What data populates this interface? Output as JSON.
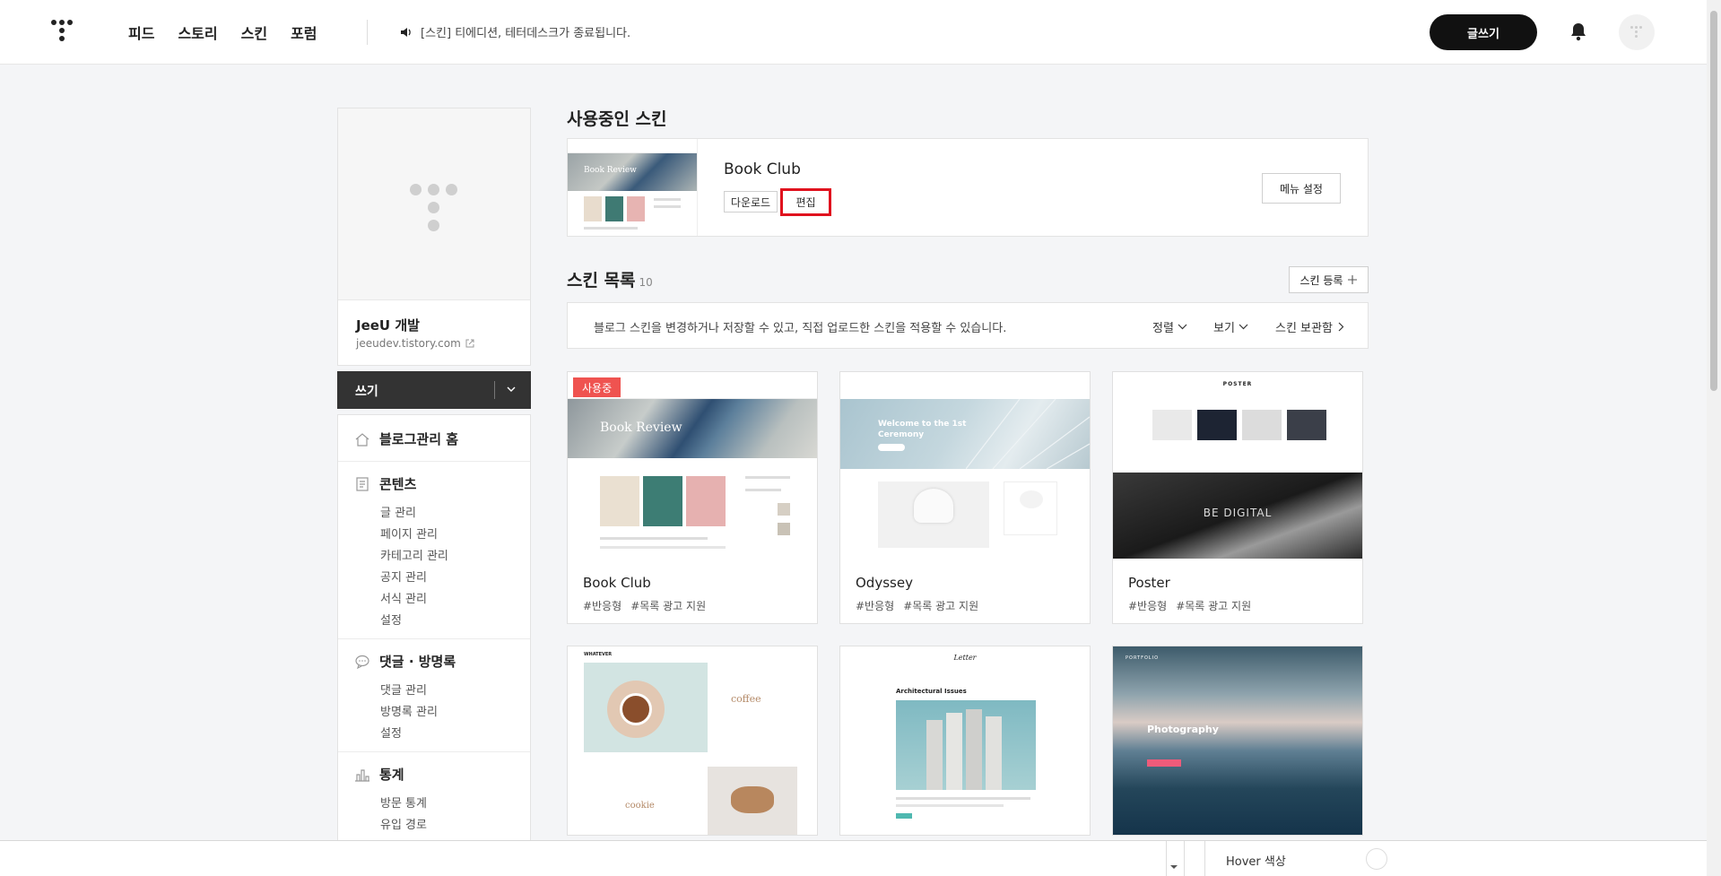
{
  "header": {
    "nav": [
      "피드",
      "스토리",
      "스킨",
      "포럼"
    ],
    "notice": "[스킨] 티에디션, 테터데스크가 종료됩니다.",
    "write_button": "글쓰기"
  },
  "sidebar": {
    "blog_name": "JeeU 개발",
    "blog_url": "jeeudev.tistory.com",
    "write_label": "쓰기",
    "sections": [
      {
        "title": "블로그관리 홈",
        "icon": "home-icon",
        "items": []
      },
      {
        "title": "콘텐츠",
        "icon": "document-icon",
        "items": [
          "글 관리",
          "페이지 관리",
          "카테고리 관리",
          "공지 관리",
          "서식 관리",
          "설정"
        ]
      },
      {
        "title": "댓글 · 방명록",
        "icon": "comment-icon",
        "items": [
          "댓글 관리",
          "방명록 관리",
          "설정"
        ]
      },
      {
        "title": "통계",
        "icon": "chart-icon",
        "items": [
          "방문 통계",
          "유입 경로"
        ]
      }
    ]
  },
  "current_skin": {
    "heading": "사용중인 스킨",
    "name": "Book Club",
    "download_label": "다운로드",
    "edit_label": "편집",
    "menu_settings_label": "메뉴 설정",
    "thumb_title": "Book Review"
  },
  "skin_list": {
    "heading": "스킨 목록",
    "count": "10",
    "register_label": "스킨 등록",
    "description": "블로그 스킨을 변경하거나 저장할 수 있고, 직접 업로드한 스킨을 적용할 수 있습니다.",
    "sort_label": "정렬",
    "view_label": "보기",
    "storage_label": "스킨 보관함",
    "in_use_badge": "사용중",
    "cards": [
      {
        "name": "Book Club",
        "tags": [
          "#반응형",
          "#목록 광고 지원"
        ],
        "thumb_text": "Book Review"
      },
      {
        "name": "Odyssey",
        "tags": [
          "#반응형",
          "#목록 광고 지원"
        ],
        "thumb_text": "Welcome to the 1st Ceremony"
      },
      {
        "name": "Poster",
        "tags": [
          "#반응형",
          "#목록 광고 지원"
        ],
        "thumb_text": "BE DIGITAL",
        "thumb_brand": "POSTER"
      },
      {
        "thumb_text": "coffee",
        "thumb_text2": "cookie",
        "thumb_brand": "WHATEVER"
      },
      {
        "thumb_text": "Architectural Issues",
        "thumb_brand": "Letter"
      },
      {
        "thumb_text": "Photography",
        "thumb_brand": "PORTFOLIO"
      }
    ]
  },
  "devtools": {
    "hover_label": "Hover 색상"
  },
  "colors": {
    "accent_badge": "#ef5350",
    "edit_highlight": "#e0121e",
    "write_button_bg": "#111111",
    "sidebar_write_bg": "#333333"
  }
}
